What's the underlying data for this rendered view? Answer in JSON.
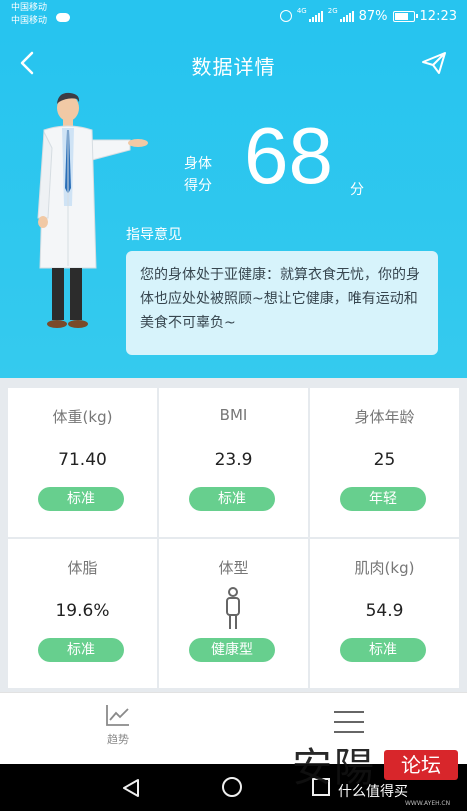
{
  "status_bar": {
    "carrier_1": "中国移动",
    "carrier_2": "中国移动",
    "sim1_tag": "4G",
    "sim2_tag": "2G",
    "battery": "87%",
    "time": "12:23"
  },
  "header": {
    "title": "数据详情",
    "back_icon": "chevron-left-icon",
    "share_icon": "paper-plane-icon"
  },
  "score": {
    "label": "身体得分",
    "value": "68",
    "unit": "分"
  },
  "advice": {
    "label": "指导意见",
    "text": "您的身体处于亚健康：就算衣食无忧，你的身体也应处处被照顾~想让它健康，唯有运动和美食不可辜负~"
  },
  "metrics": [
    {
      "name": "体重(kg)",
      "value": "71.40",
      "status": "标准"
    },
    {
      "name": "BMI",
      "value": "23.9",
      "status": "标准"
    },
    {
      "name": "身体年龄",
      "value": "25",
      "status": "年轻"
    },
    {
      "name": "体脂",
      "value": "19.6%",
      "status": "标准"
    },
    {
      "name": "体型",
      "value": "",
      "status": "健康型",
      "icon": "person-icon"
    },
    {
      "name": "肌肉(kg)",
      "value": "54.9",
      "status": "标准"
    }
  ],
  "tabbar": {
    "trend_label": "趋势",
    "trend_icon": "line-chart-icon",
    "menu_icon": "menu-icon"
  },
  "watermark": {
    "glyphs": "安陽",
    "badge": "论坛",
    "site": "什么值得买",
    "url": "WWW.AYEH.CN"
  },
  "colors": {
    "header_blue": "#27c4ef",
    "badge_green": "#67cf8e",
    "advice_bg": "#d7f3fb"
  }
}
